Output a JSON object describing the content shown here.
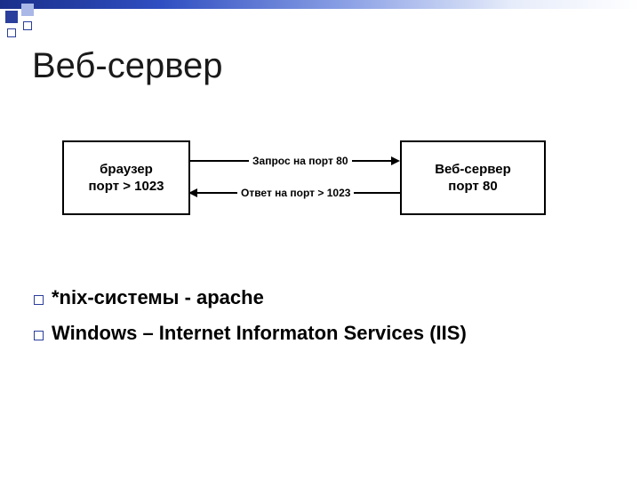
{
  "title": "Веб-сервер",
  "diagram": {
    "left_box_line1": "браузер",
    "left_box_line2": "порт > 1023",
    "right_box_line1": "Веб-сервер",
    "right_box_line2": "порт 80",
    "arrow_top_label": "Запрос на порт 80",
    "arrow_bottom_label": "Ответ на порт > 1023"
  },
  "bullets": {
    "line1": "*nix-системы -  apache",
    "line2": "Windows – Internet Informaton Services (IIS)"
  }
}
